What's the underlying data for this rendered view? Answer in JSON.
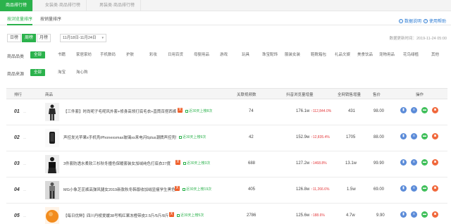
{
  "main_tabs": [
    {
      "label": "商品排行榜",
      "active": true
    },
    {
      "label": "女装类·商品排行榜",
      "active": false
    },
    {
      "label": "男装类·商品排行榜",
      "active": false
    }
  ],
  "sub_tabs": [
    {
      "label": "按浏览量排序",
      "active": true
    },
    {
      "label": "按销量排序",
      "active": false
    }
  ],
  "links": {
    "data_help": "数据说明",
    "usage_help": "使用帮助"
  },
  "periods": [
    {
      "label": "日榜",
      "active": false
    },
    {
      "label": "周榜",
      "active": true
    },
    {
      "label": "月榜",
      "active": false
    }
  ],
  "date_range": "11月18日-11月24日",
  "updated": "数据更新时间：2019-11-24 05:00",
  "category": {
    "label": "商品品类",
    "options": [
      "全部",
      "书籍",
      "家居家纺",
      "手机数码",
      "护肤",
      "彩妆",
      "日用百货",
      "母婴用品",
      "游戏",
      "玩具",
      "珠宝配饰",
      "服装女装",
      "鞋靴箱包",
      "礼品文娱",
      "美食饮品",
      "宠物用品",
      "花鸟绿植",
      "其他"
    ]
  },
  "source": {
    "label": "商品来源",
    "options": [
      "全部",
      "淘宝",
      "淘心购"
    ]
  },
  "table": {
    "headers": {
      "rank": "排行",
      "product": "商品",
      "related": "关联视频数",
      "views": "抖音浏览量增量",
      "sales": "全网销售增量",
      "price": "售价",
      "ops": "操作"
    },
    "rows": [
      {
        "rank": "01",
        "title": "【三件套】时尚呢子毛呢风外套+修身高领打底毛衣+直筒百搭西裤",
        "tag": "近30天上榜8次",
        "related": "74",
        "views": "176.1w",
        "growth": "112,844.0%",
        "sales": "431",
        "price": "98.00"
      },
      {
        "rank": "02",
        "title": "声控发光苹果x手机壳iPhonexsmax玻璃xs来电闪6plus潮牌声控壳情侣款",
        "tag": "近30天上榜9次",
        "related": "42",
        "views": "152.9w",
        "growth": "12,835.4%",
        "sales": "1705",
        "price": "88.00"
      },
      {
        "rank": "03",
        "title": "3件套防透水柔软三杉秋冬撞色保暖套装女加绒纯色打底衣27度",
        "tag": "近30天上榜3次",
        "related": "688",
        "views": "127.2w",
        "growth": "1468.8%",
        "sales": "13.1w",
        "price": "99.90"
      },
      {
        "rank": "04",
        "title": "MG小象芝芘裤高弹风腿女2019新款秋冬韩版收加绒显瘦学生黑色运动裤",
        "tag": "近30天上榜19次",
        "related": "405",
        "views": "126.8w",
        "growth": "11,266.6%",
        "sales": "1.5w",
        "price": "69.00"
      },
      {
        "rank": "05",
        "title": "【每日优鲜】四川丹棱爱媛38号鸭红果冻橙带皮2.5斤/5斤/8斤",
        "tag": "近30天上榜5次",
        "related": "2786",
        "views": "125.6w",
        "growth": "188.6%",
        "sales": "4.7w",
        "price": "9.90"
      }
    ]
  },
  "icons": [
    "chart-icon",
    "document-icon",
    "message-icon",
    "cart-icon"
  ],
  "colors": {
    "accent": "#2bb24c",
    "link": "#2a7ad3",
    "increase": "#e4393c",
    "act_blue": "#5b8bd8",
    "act_green": "#3fbf5a",
    "act_orange": "#f0683c"
  }
}
